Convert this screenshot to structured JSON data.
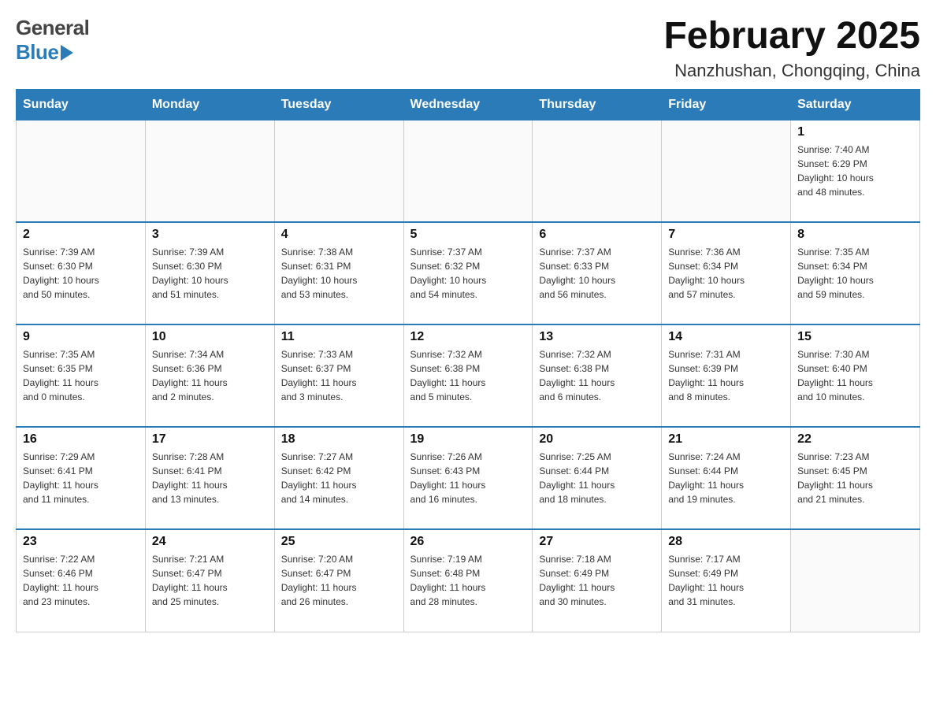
{
  "header": {
    "logo_general": "General",
    "logo_blue": "Blue",
    "month_title": "February 2025",
    "location": "Nanzhushan, Chongqing, China"
  },
  "weekdays": [
    "Sunday",
    "Monday",
    "Tuesday",
    "Wednesday",
    "Thursday",
    "Friday",
    "Saturday"
  ],
  "weeks": [
    {
      "days": [
        {
          "number": "",
          "info": ""
        },
        {
          "number": "",
          "info": ""
        },
        {
          "number": "",
          "info": ""
        },
        {
          "number": "",
          "info": ""
        },
        {
          "number": "",
          "info": ""
        },
        {
          "number": "",
          "info": ""
        },
        {
          "number": "1",
          "info": "Sunrise: 7:40 AM\nSunset: 6:29 PM\nDaylight: 10 hours\nand 48 minutes."
        }
      ]
    },
    {
      "days": [
        {
          "number": "2",
          "info": "Sunrise: 7:39 AM\nSunset: 6:30 PM\nDaylight: 10 hours\nand 50 minutes."
        },
        {
          "number": "3",
          "info": "Sunrise: 7:39 AM\nSunset: 6:30 PM\nDaylight: 10 hours\nand 51 minutes."
        },
        {
          "number": "4",
          "info": "Sunrise: 7:38 AM\nSunset: 6:31 PM\nDaylight: 10 hours\nand 53 minutes."
        },
        {
          "number": "5",
          "info": "Sunrise: 7:37 AM\nSunset: 6:32 PM\nDaylight: 10 hours\nand 54 minutes."
        },
        {
          "number": "6",
          "info": "Sunrise: 7:37 AM\nSunset: 6:33 PM\nDaylight: 10 hours\nand 56 minutes."
        },
        {
          "number": "7",
          "info": "Sunrise: 7:36 AM\nSunset: 6:34 PM\nDaylight: 10 hours\nand 57 minutes."
        },
        {
          "number": "8",
          "info": "Sunrise: 7:35 AM\nSunset: 6:34 PM\nDaylight: 10 hours\nand 59 minutes."
        }
      ]
    },
    {
      "days": [
        {
          "number": "9",
          "info": "Sunrise: 7:35 AM\nSunset: 6:35 PM\nDaylight: 11 hours\nand 0 minutes."
        },
        {
          "number": "10",
          "info": "Sunrise: 7:34 AM\nSunset: 6:36 PM\nDaylight: 11 hours\nand 2 minutes."
        },
        {
          "number": "11",
          "info": "Sunrise: 7:33 AM\nSunset: 6:37 PM\nDaylight: 11 hours\nand 3 minutes."
        },
        {
          "number": "12",
          "info": "Sunrise: 7:32 AM\nSunset: 6:38 PM\nDaylight: 11 hours\nand 5 minutes."
        },
        {
          "number": "13",
          "info": "Sunrise: 7:32 AM\nSunset: 6:38 PM\nDaylight: 11 hours\nand 6 minutes."
        },
        {
          "number": "14",
          "info": "Sunrise: 7:31 AM\nSunset: 6:39 PM\nDaylight: 11 hours\nand 8 minutes."
        },
        {
          "number": "15",
          "info": "Sunrise: 7:30 AM\nSunset: 6:40 PM\nDaylight: 11 hours\nand 10 minutes."
        }
      ]
    },
    {
      "days": [
        {
          "number": "16",
          "info": "Sunrise: 7:29 AM\nSunset: 6:41 PM\nDaylight: 11 hours\nand 11 minutes."
        },
        {
          "number": "17",
          "info": "Sunrise: 7:28 AM\nSunset: 6:41 PM\nDaylight: 11 hours\nand 13 minutes."
        },
        {
          "number": "18",
          "info": "Sunrise: 7:27 AM\nSunset: 6:42 PM\nDaylight: 11 hours\nand 14 minutes."
        },
        {
          "number": "19",
          "info": "Sunrise: 7:26 AM\nSunset: 6:43 PM\nDaylight: 11 hours\nand 16 minutes."
        },
        {
          "number": "20",
          "info": "Sunrise: 7:25 AM\nSunset: 6:44 PM\nDaylight: 11 hours\nand 18 minutes."
        },
        {
          "number": "21",
          "info": "Sunrise: 7:24 AM\nSunset: 6:44 PM\nDaylight: 11 hours\nand 19 minutes."
        },
        {
          "number": "22",
          "info": "Sunrise: 7:23 AM\nSunset: 6:45 PM\nDaylight: 11 hours\nand 21 minutes."
        }
      ]
    },
    {
      "days": [
        {
          "number": "23",
          "info": "Sunrise: 7:22 AM\nSunset: 6:46 PM\nDaylight: 11 hours\nand 23 minutes."
        },
        {
          "number": "24",
          "info": "Sunrise: 7:21 AM\nSunset: 6:47 PM\nDaylight: 11 hours\nand 25 minutes."
        },
        {
          "number": "25",
          "info": "Sunrise: 7:20 AM\nSunset: 6:47 PM\nDaylight: 11 hours\nand 26 minutes."
        },
        {
          "number": "26",
          "info": "Sunrise: 7:19 AM\nSunset: 6:48 PM\nDaylight: 11 hours\nand 28 minutes."
        },
        {
          "number": "27",
          "info": "Sunrise: 7:18 AM\nSunset: 6:49 PM\nDaylight: 11 hours\nand 30 minutes."
        },
        {
          "number": "28",
          "info": "Sunrise: 7:17 AM\nSunset: 6:49 PM\nDaylight: 11 hours\nand 31 minutes."
        },
        {
          "number": "",
          "info": ""
        }
      ]
    }
  ]
}
